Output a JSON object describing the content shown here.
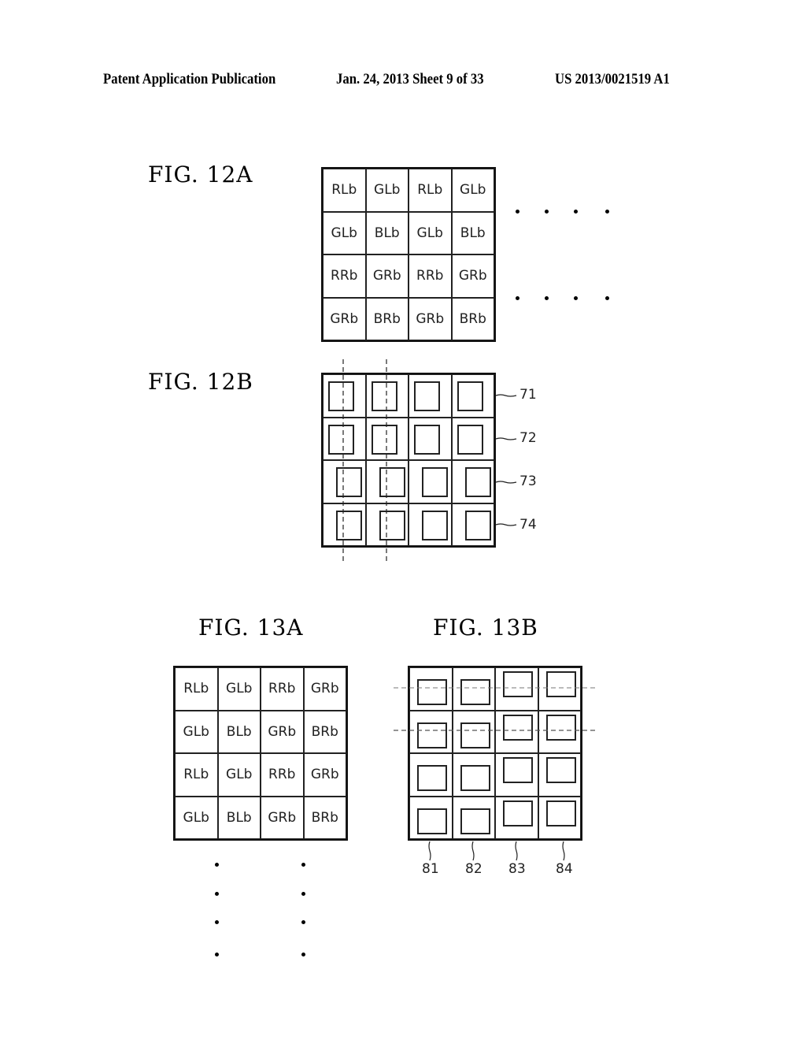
{
  "header": {
    "left": "Patent Application Publication",
    "center": "Jan. 24, 2013  Sheet 9 of 33",
    "right": "US 2013/0021519 A1"
  },
  "figures": {
    "fig12a": {
      "title": "FIG.  12A",
      "cells": [
        [
          "RLb",
          "GLb",
          "RLb",
          "GLb"
        ],
        [
          "GLb",
          "BLb",
          "GLb",
          "BLb"
        ],
        [
          "RRb",
          "GRb",
          "RRb",
          "GRb"
        ],
        [
          "GRb",
          "BRb",
          "GRb",
          "BRb"
        ]
      ],
      "continuation": "horizontal ellipsis (4 dots) after rows 1 and 3"
    },
    "fig12b": {
      "title": "FIG.  12B",
      "row_refs": [
        "71",
        "72",
        "73",
        "74"
      ]
    },
    "fig13a": {
      "title": "FIG.  13A",
      "cells": [
        [
          "RLb",
          "GLb",
          "RRb",
          "GRb"
        ],
        [
          "GLb",
          "BLb",
          "GRb",
          "BRb"
        ],
        [
          "RLb",
          "GLb",
          "RRb",
          "GRb"
        ],
        [
          "GLb",
          "BLb",
          "GRb",
          "BRb"
        ]
      ],
      "continuation": "vertical ellipsis (4 dots) below columns 1 and 3"
    },
    "fig13b": {
      "title": "FIG.  13B",
      "col_refs": [
        "81",
        "82",
        "83",
        "84"
      ]
    }
  }
}
